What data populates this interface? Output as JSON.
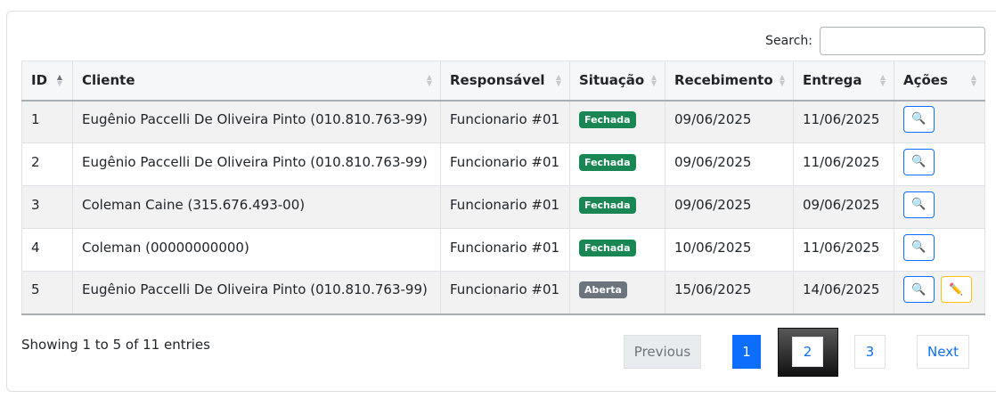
{
  "search": {
    "label": "Search:",
    "value": "",
    "placeholder": ""
  },
  "table": {
    "columns": [
      "ID",
      "Cliente",
      "Responsável",
      "Situação",
      "Recebimento",
      "Entrega",
      "Ações"
    ],
    "rows": [
      {
        "id": "1",
        "cliente": "Eugênio Paccelli De Oliveira Pinto (010.810.763-99)",
        "responsavel": "Funcionario #01",
        "situacao": "Fechada",
        "recebimento": "09/06/2025",
        "entrega": "11/06/2025"
      },
      {
        "id": "2",
        "cliente": "Eugênio Paccelli De Oliveira Pinto (010.810.763-99)",
        "responsavel": "Funcionario #01",
        "situacao": "Fechada",
        "recebimento": "09/06/2025",
        "entrega": "11/06/2025"
      },
      {
        "id": "3",
        "cliente": "Coleman Caine (315.676.493-00)",
        "responsavel": "Funcionario #01",
        "situacao": "Fechada",
        "recebimento": "09/06/2025",
        "entrega": "09/06/2025"
      },
      {
        "id": "4",
        "cliente": "Coleman (00000000000)",
        "responsavel": "Funcionario #01",
        "situacao": "Fechada",
        "recebimento": "10/06/2025",
        "entrega": "11/06/2025"
      },
      {
        "id": "5",
        "cliente": "Eugênio Paccelli De Oliveira Pinto (010.810.763-99)",
        "responsavel": "Funcionario #01",
        "situacao": "Aberta",
        "recebimento": "15/06/2025",
        "entrega": "14/06/2025"
      }
    ],
    "icons": {
      "view": "magnifier-icon",
      "edit": "pencil-icon",
      "sort": "sort-arrows-icon"
    }
  },
  "footer": {
    "info": "Showing 1 to 5 of 11 entries",
    "previous": "Previous",
    "pages": [
      "1",
      "2",
      "3"
    ],
    "next": "Next"
  },
  "colors": {
    "closed_badge": "#198754",
    "open_badge": "#6c757d",
    "primary": "#0d6efd",
    "warning": "#ffc107"
  }
}
